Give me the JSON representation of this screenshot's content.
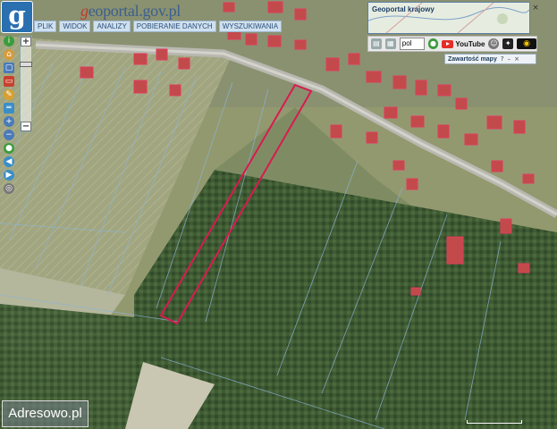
{
  "app": {
    "brand_prefix": "g",
    "brand_main": "eoportal.gov.pl"
  },
  "menu": {
    "items": [
      "PLIK",
      "WIDOK",
      "ANALIZY",
      "POBIERANIE DANYCH",
      "WYSZUKIWANIA"
    ]
  },
  "overview": {
    "title": "Geoportal krajowy",
    "close": "×"
  },
  "toolbar": {
    "language": "pol",
    "youtube_label": "YouTube"
  },
  "content_panel": {
    "label": "Zawartość mapy",
    "help": "?",
    "minimize": "–",
    "close": "×"
  },
  "zoom": {
    "plus": "+",
    "minus": "−"
  },
  "watermark": "Adresowo.pl",
  "colors": {
    "parcel_outline": "#d81b50",
    "brand_blue": "#2a6fb0",
    "menu_bg": "#cfe0ef"
  },
  "icons": {
    "left_tools": [
      "info-icon",
      "home-icon",
      "select-icon",
      "draw-icon",
      "pen-icon",
      "measure-icon",
      "zoom-in-icon",
      "zoom-out-icon",
      "globe-icon",
      "arrow-left-icon",
      "arrow-right-icon",
      "target-icon"
    ]
  }
}
